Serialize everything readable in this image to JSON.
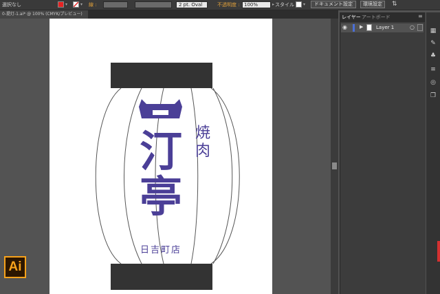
{
  "control_bar": {
    "selection_label": "選択なし",
    "stroke_label": "線 :",
    "brush_value": "2 pt. Oval",
    "opacity_label": "不透明度 :",
    "opacity_value": "100%",
    "style_label": "スタイル :",
    "document_setup_button": "ドキュメント設定",
    "preferences_button": "環境設定",
    "fill_color": "#e52222",
    "accent_color": "#e0a03a"
  },
  "document_tab": {
    "label": "0-提灯-1.ai* @ 100% (CMYK/プレビュー)"
  },
  "panel": {
    "tabs": [
      "レイヤー",
      "アートボード"
    ],
    "layers": [
      {
        "name": "Layer 1"
      }
    ]
  },
  "artwork": {
    "top_chars": [
      "焼",
      "肉"
    ],
    "main_chars": [
      "汀",
      "亭"
    ],
    "store_name": "日吉町店",
    "text_color": "#4b3f97"
  },
  "logo": {
    "text": "Ai"
  }
}
